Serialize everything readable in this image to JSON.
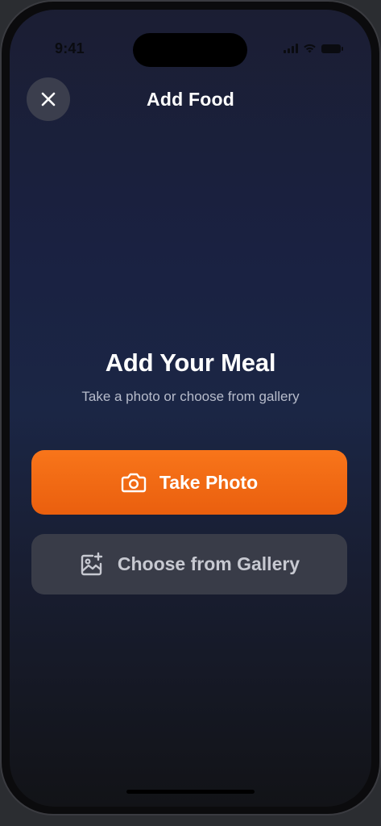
{
  "status_bar": {
    "time": "9:41",
    "signal_icon": "cellular-signal-icon",
    "wifi_icon": "wifi-icon",
    "battery_icon": "battery-icon"
  },
  "header": {
    "title": "Add Food",
    "close_icon": "close-icon"
  },
  "hero": {
    "title": "Add Your Meal",
    "subtitle": "Take a photo or choose from gallery"
  },
  "actions": {
    "take_photo": {
      "label": "Take Photo",
      "icon": "camera-icon",
      "color": "#f26a14"
    },
    "choose_gallery": {
      "label": "Choose from Gallery",
      "icon": "image-plus-icon",
      "color": "#393c48"
    }
  },
  "colors": {
    "accent": "#f26a14",
    "background_top": "#1b1e33",
    "background_bottom": "#121317"
  }
}
